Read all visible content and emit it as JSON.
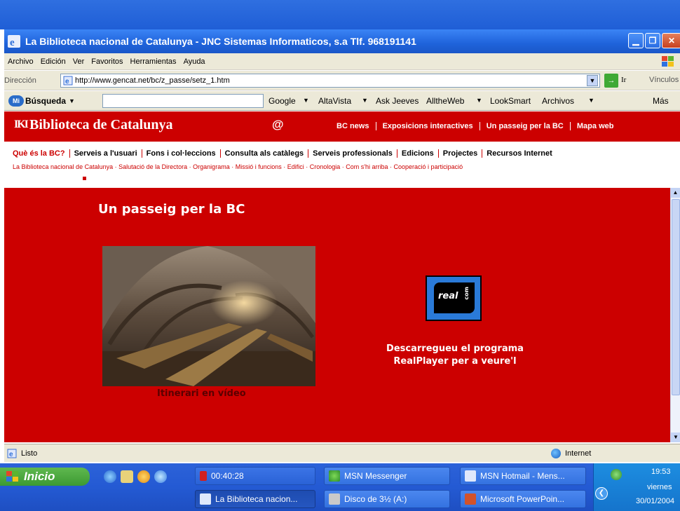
{
  "window": {
    "title": "La Biblioteca nacional de Catalunya - JNC Sistemas Informaticos, s.a  Tlf. 968191141"
  },
  "menu": [
    "Archivo",
    "Edición",
    "Ver",
    "Favoritos",
    "Herramientas",
    "Ayuda"
  ],
  "address": {
    "label": "Dirección",
    "url": "http://www.gencat.net/bc/z_passe/setz_1.htm",
    "go_label": "Ir",
    "links_label": "Vínculos"
  },
  "search_toolbar": {
    "brand": "Búsqueda",
    "engines": [
      "Google",
      "AltaVista",
      "Ask Jeeves",
      "AlltheWeb",
      "LookSmart",
      "Archivos"
    ],
    "more": "Más"
  },
  "site": {
    "logo": "Biblioteca de Catalunya",
    "logo_mark": "IKI",
    "at": "@",
    "top_links": [
      "BC news",
      "Exposicions interactives",
      "Un passeig per la BC",
      "Mapa web"
    ],
    "main_nav": [
      "Què és la BC?",
      "Serveis a l'usuari",
      "Fons i col·leccions",
      "Consulta als catàlegs",
      "Serveis professionals",
      "Edicions",
      "Projectes",
      "Recursos Internet"
    ],
    "sub_nav": [
      "La Biblioteca nacional de Catalunya",
      "Salutació de la Directora",
      "Organigrama",
      "Missió i funcions",
      "Edifici",
      "Cronologia",
      "Com s'hi arriba",
      "Cooperació i participació"
    ],
    "page_title": "Un passeig per la BC",
    "video_caption": "Itinerari en vídeo",
    "real_logo": "real",
    "real_logo_com": "com",
    "download_line1": "Descarregueu el programa",
    "download_line2": "RealPlayer per a veure'l"
  },
  "status": {
    "text": "Listo",
    "zone": "Internet"
  },
  "taskbar": {
    "start": "Inicio",
    "tasks_row1": [
      "00:40:28",
      "MSN Messenger",
      "MSN Hotmail - Mens..."
    ],
    "tasks_row2": [
      "La Biblioteca nacion...",
      "Disco de 3½ (A:)",
      "Microsoft PowerPoin..."
    ],
    "clock": "19:53",
    "day": "viernes",
    "date": "30/01/2004"
  },
  "colors": {
    "site_red": "#cc0000",
    "xp_blue": "#245ad3",
    "start_green": "#3c9a32"
  }
}
